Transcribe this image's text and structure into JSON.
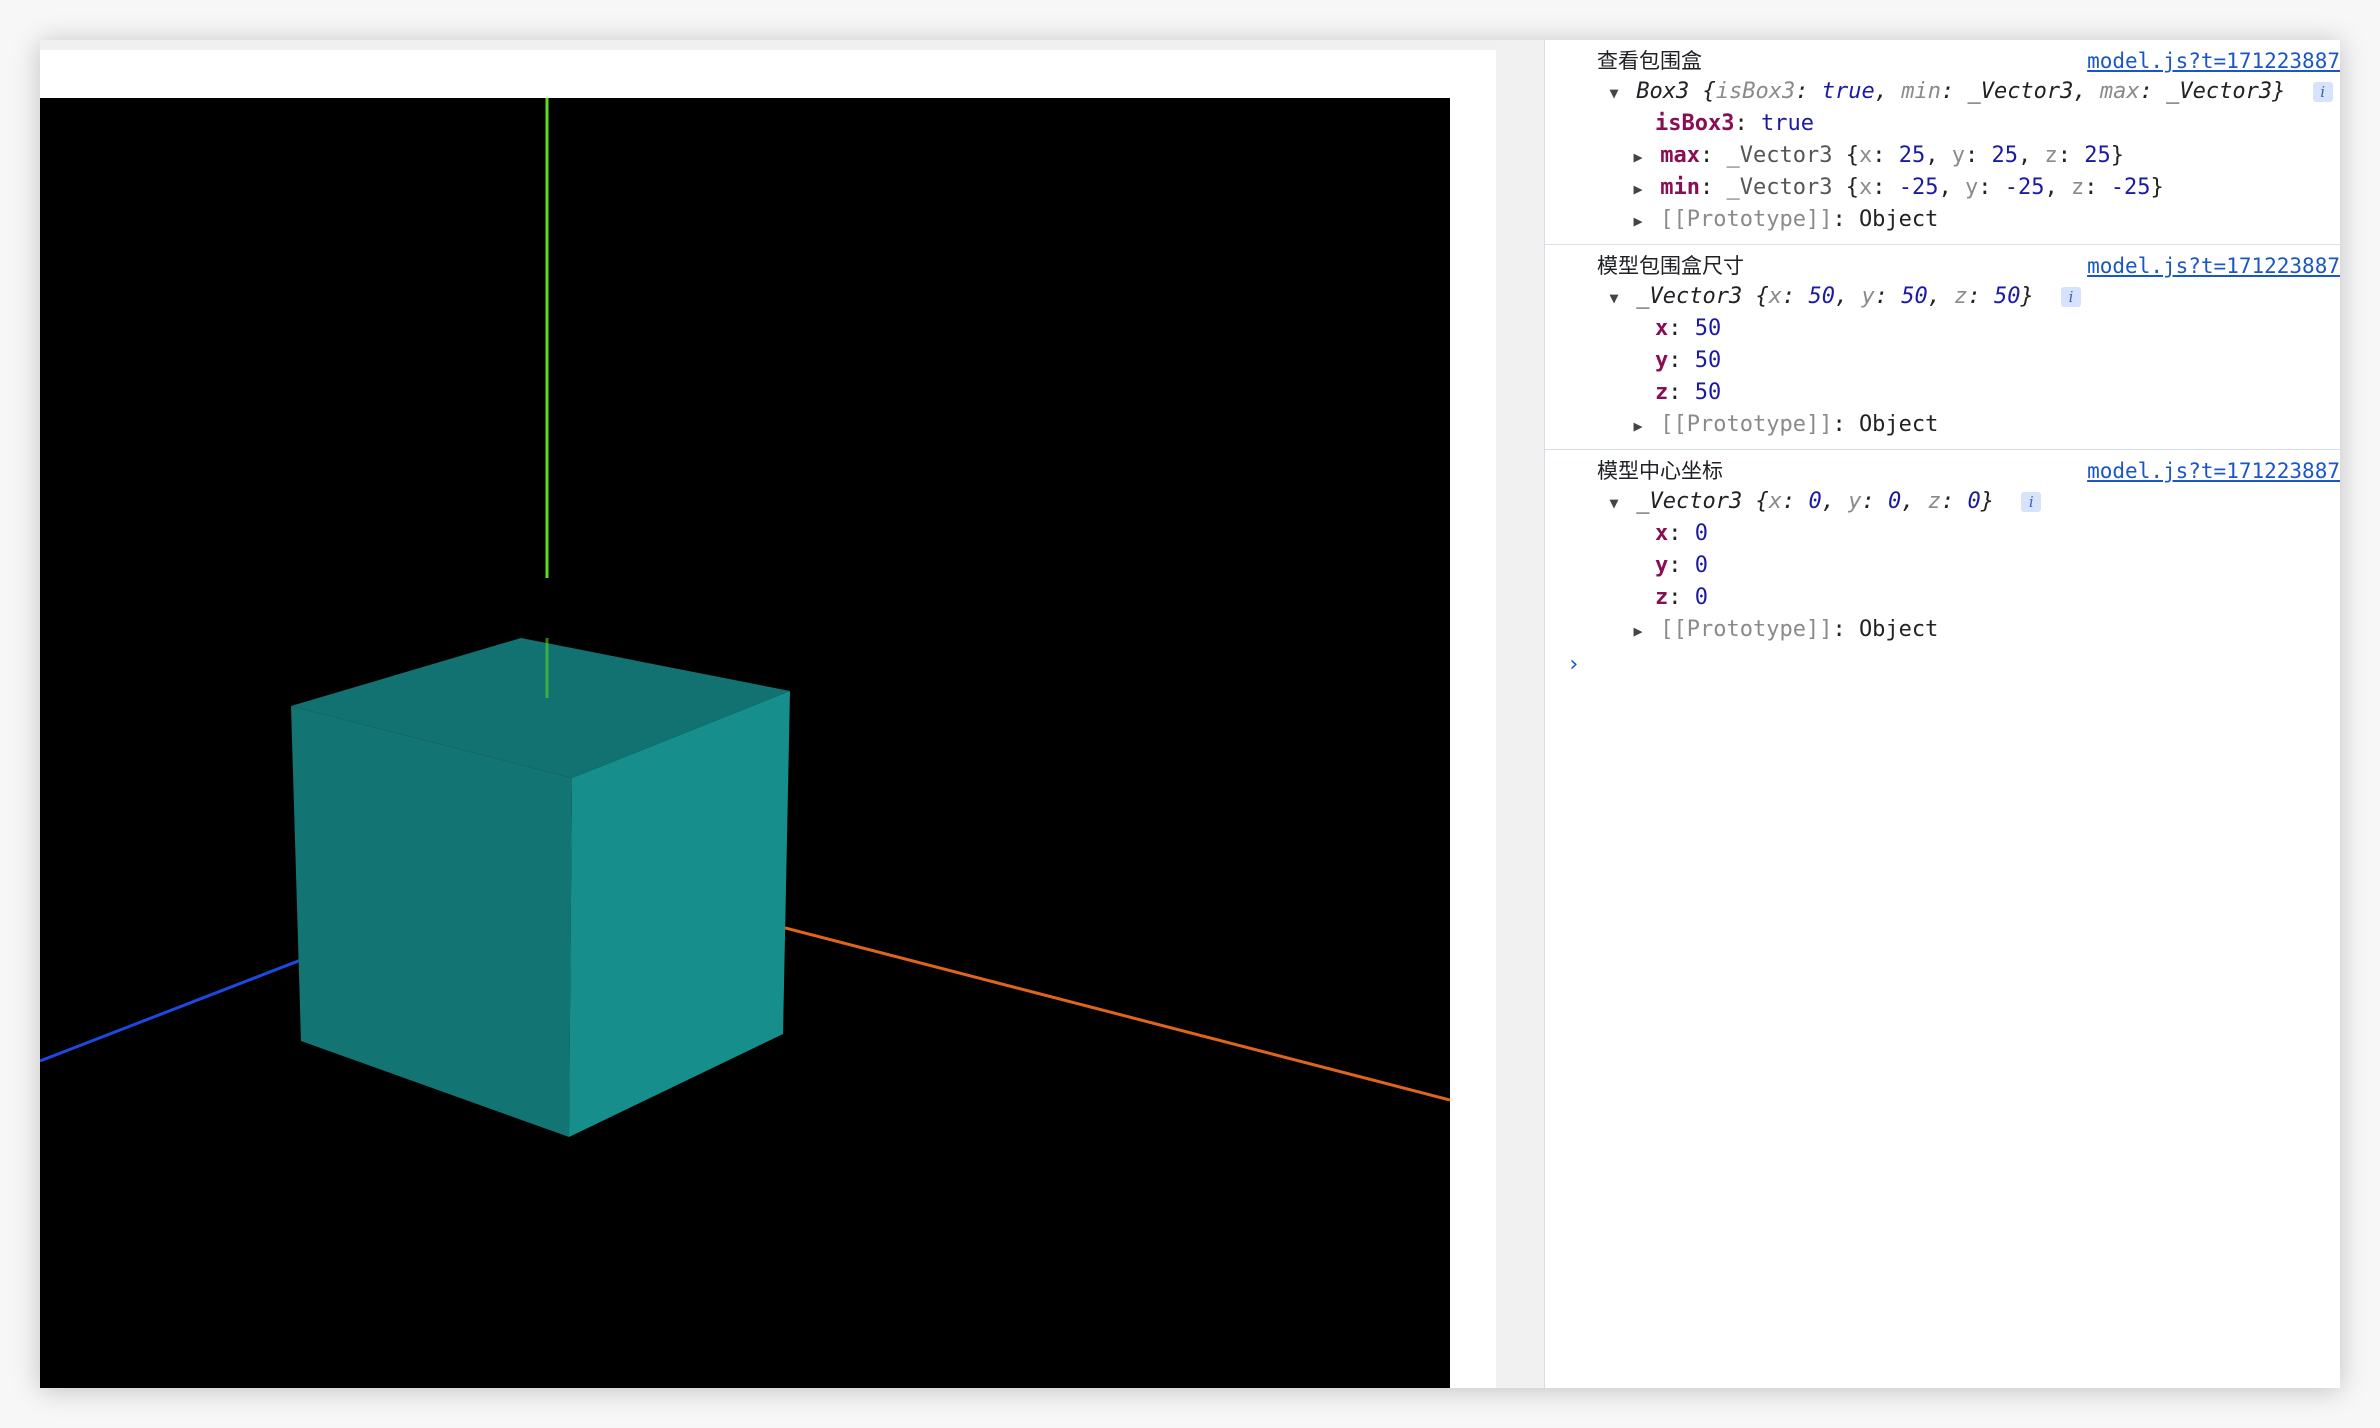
{
  "console": {
    "groups": [
      {
        "message": "查看包围盒",
        "source": "model.js?t=171223887",
        "object": {
          "class": "Box3",
          "preview": [
            {
              "key": "isBox3",
              "value": "true"
            },
            {
              "key": "min",
              "value": "_Vector3"
            },
            {
              "key": "max",
              "value": "_Vector3"
            }
          ]
        },
        "props": [
          {
            "key": "isBox3",
            "value": "true",
            "expandable": false
          },
          {
            "key": "max",
            "value_class": "_Vector3",
            "preview": [
              {
                "key": "x",
                "value": "25"
              },
              {
                "key": "y",
                "value": "25"
              },
              {
                "key": "z",
                "value": "25"
              }
            ],
            "expandable": true
          },
          {
            "key": "min",
            "value_class": "_Vector3",
            "preview": [
              {
                "key": "x",
                "value": "-25"
              },
              {
                "key": "y",
                "value": "-25"
              },
              {
                "key": "z",
                "value": "-25"
              }
            ],
            "expandable": true
          }
        ],
        "prototype": "[[Prototype]]",
        "prototype_value": "Object"
      },
      {
        "message": "模型包围盒尺寸",
        "source": "model.js?t=171223887",
        "object": {
          "class": "_Vector3",
          "preview": [
            {
              "key": "x",
              "value": "50"
            },
            {
              "key": "y",
              "value": "50"
            },
            {
              "key": "z",
              "value": "50"
            }
          ]
        },
        "props": [
          {
            "key": "x",
            "value": "50"
          },
          {
            "key": "y",
            "value": "50"
          },
          {
            "key": "z",
            "value": "50"
          }
        ],
        "prototype": "[[Prototype]]",
        "prototype_value": "Object"
      },
      {
        "message": "模型中心坐标",
        "source": "model.js?t=171223887",
        "object": {
          "class": "_Vector3",
          "preview": [
            {
              "key": "x",
              "value": "0"
            },
            {
              "key": "y",
              "value": "0"
            },
            {
              "key": "z",
              "value": "0"
            }
          ]
        },
        "props": [
          {
            "key": "x",
            "value": "0"
          },
          {
            "key": "y",
            "value": "0"
          },
          {
            "key": "z",
            "value": "0"
          }
        ],
        "prototype": "[[Prototype]]",
        "prototype_value": "Object"
      }
    ],
    "prompt_symbol": "›",
    "info_glyph": "i"
  },
  "scene": {
    "background": "#000000",
    "cube_colors": {
      "top": "#127272",
      "front_left": "#137474",
      "right": "#158e8c"
    },
    "axis_colors": {
      "x": "#e0651c",
      "y": "#5ce01c",
      "z": "#1c49e0"
    }
  }
}
